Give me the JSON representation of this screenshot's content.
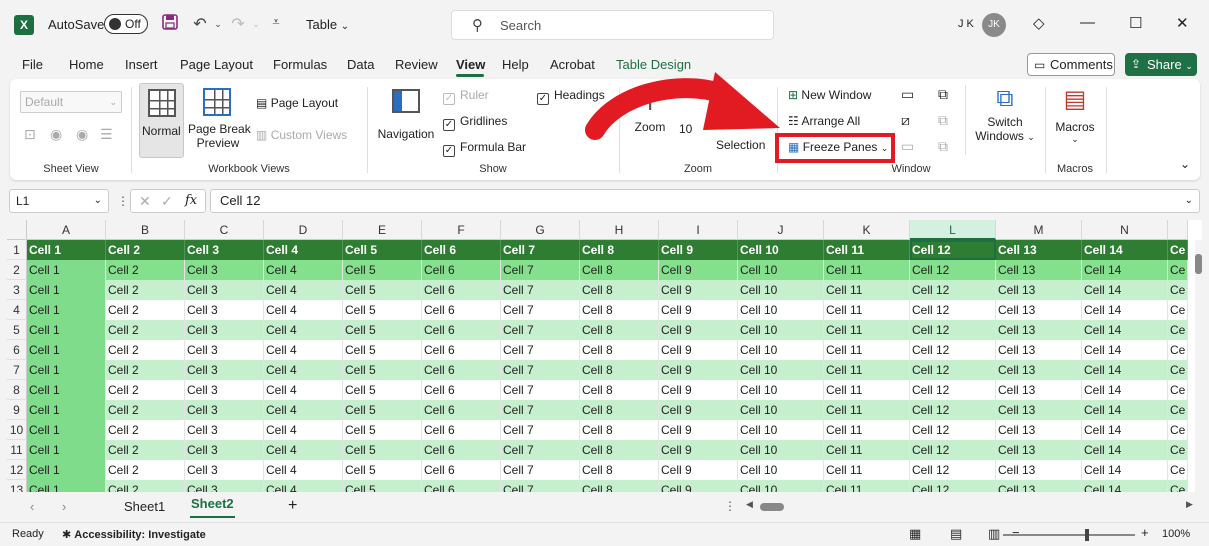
{
  "titlebar": {
    "autosave_label": "AutoSave",
    "autosave_state": "Off",
    "doc_title": "Table",
    "search_placeholder": "Search",
    "user_initials": "J K",
    "avatar_initials": "JK"
  },
  "menu": {
    "tabs": [
      "File",
      "Home",
      "Insert",
      "Page Layout",
      "Formulas",
      "Data",
      "Review",
      "View",
      "Help",
      "Acrobat",
      "Table Design"
    ],
    "active_tab": "View",
    "comments_label": "Comments",
    "share_label": "Share"
  },
  "ribbon": {
    "sheet_view": {
      "label": "Sheet View",
      "select_value": "Default"
    },
    "workbook_views": {
      "label": "Workbook Views",
      "normal": "Normal",
      "page_break_1": "Page Break",
      "page_break_2": "Preview",
      "page_layout": "Page Layout",
      "custom_views": "Custom Views"
    },
    "show": {
      "label": "Show",
      "navigation": "Navigation",
      "ruler": "Ruler",
      "gridlines": "Gridlines",
      "formula_bar": "Formula Bar",
      "headings": "Headings"
    },
    "zoom": {
      "label": "Zoom",
      "zoom": "Zoom",
      "hundred": "10",
      "selection": "Selection"
    },
    "window": {
      "label": "Window",
      "new_window": "New Window",
      "arrange_all": "Arrange All",
      "freeze_panes": "Freeze Panes",
      "switch_1": "Switch",
      "switch_2": "Windows"
    },
    "macros": {
      "label": "Macros",
      "macros": "Macros"
    }
  },
  "formula_bar": {
    "name_box": "L1",
    "content": "Cell 12"
  },
  "grid": {
    "columns": [
      "A",
      "B",
      "C",
      "D",
      "E",
      "F",
      "G",
      "H",
      "I",
      "J",
      "K",
      "L",
      "M",
      "N",
      ""
    ],
    "selected_column": "L",
    "rows": [
      "1",
      "2",
      "3",
      "4",
      "5",
      "6",
      "7",
      "8",
      "9",
      "10",
      "11",
      "12",
      "13"
    ],
    "header_cells": [
      "Cell 1",
      "Cell 2",
      "Cell 3",
      "Cell 4",
      "Cell 5",
      "Cell 6",
      "Cell 7",
      "Cell 8",
      "Cell 9",
      "Cell 10",
      "Cell 11",
      "Cell 12",
      "Cell 13",
      "Cell 14",
      "Ce"
    ],
    "body_cells": [
      "Cell 1",
      "Cell 2",
      "Cell 3",
      "Cell 4",
      "Cell 5",
      "Cell 6",
      "Cell 7",
      "Cell 8",
      "Cell 9",
      "Cell 10",
      "Cell 11",
      "Cell 12",
      "Cell 13",
      "Cell 14",
      "Ce"
    ]
  },
  "sheets": {
    "tabs": [
      "Sheet1",
      "Sheet2"
    ],
    "active": "Sheet2"
  },
  "status": {
    "ready": "Ready",
    "accessibility": "Accessibility: Investigate",
    "zoom": "100%"
  },
  "colors": {
    "accent": "#1d6f42",
    "highlight_box": "#e21b23",
    "header_row": "#2e7d32",
    "band_row": "#c6efce"
  }
}
